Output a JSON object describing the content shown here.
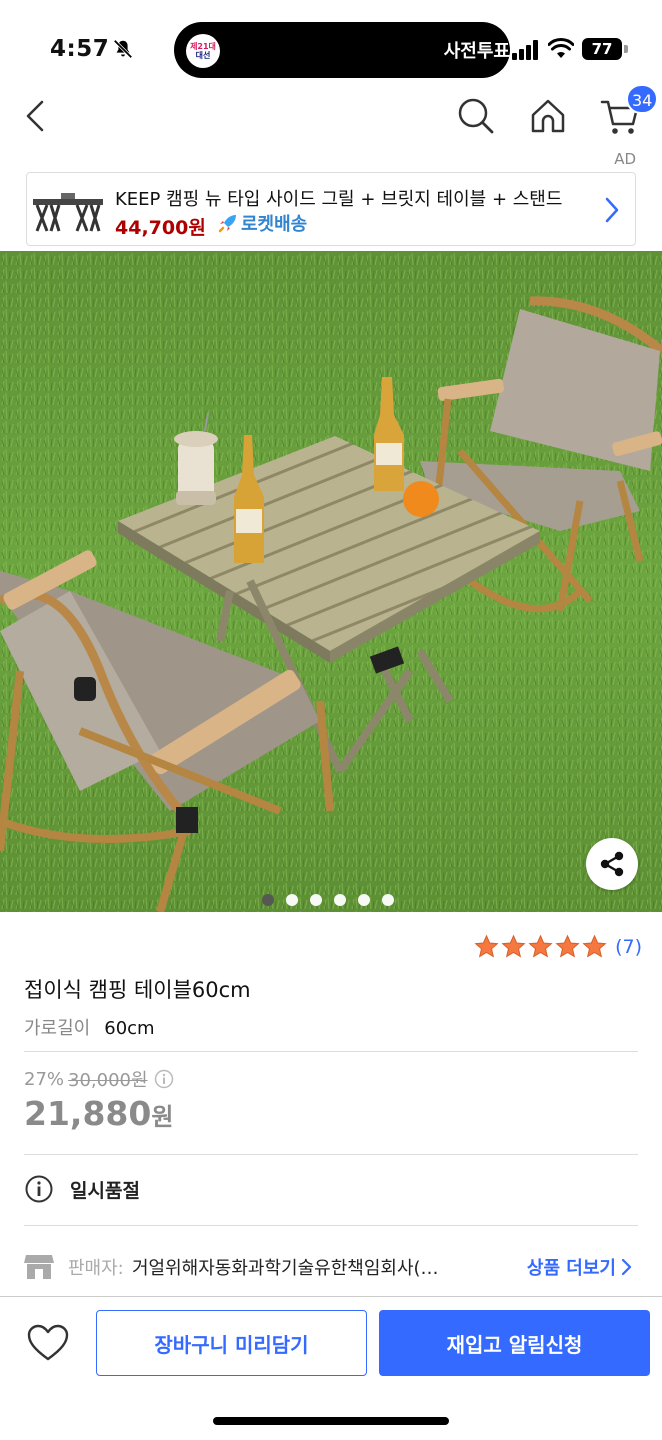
{
  "status_bar": {
    "time": "4:57",
    "island_logo_line1": "제21대",
    "island_logo_line2": "대선",
    "island_text": "사전투표",
    "battery": "77"
  },
  "header": {
    "cart_count": "34"
  },
  "ad": {
    "label": "AD",
    "title": "KEEP 캠핑 뉴 타입 사이드 그릴 + 브릿지 테이블 + 스탠드",
    "price": "44,700원",
    "delivery": "로켓배송"
  },
  "gallery": {
    "image_count": 6,
    "active_index": 0
  },
  "rating": {
    "stars": 5,
    "count": "(7)"
  },
  "product": {
    "title": "접이식 캠핑 테이블60cm",
    "option_label": "가로길이",
    "option_value": "60cm",
    "discount_rate": "27%",
    "original_price": "30,000원",
    "price": "21,880",
    "price_unit": "원",
    "soldout": "일시품절"
  },
  "seller": {
    "label": "판매자:",
    "name": "거얼위해자동화과학기술유한책임회사(…",
    "more": "상품 더보기"
  },
  "bottom": {
    "cart_button": "장바구니 미리담기",
    "restock_button": "재입고 알림신청"
  },
  "colors": {
    "accent": "#346aff",
    "ad_price": "#ae0000",
    "star": "#f4783f",
    "rocket_text": "#3185d0"
  }
}
